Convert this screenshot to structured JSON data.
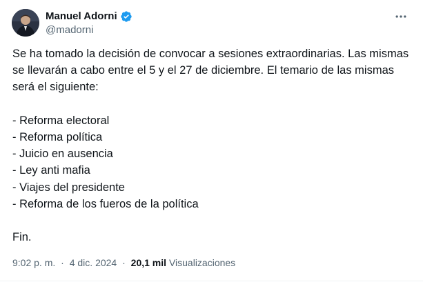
{
  "author": {
    "display_name": "Manuel Adorni",
    "handle": "@madorni",
    "verified": true
  },
  "tweet": {
    "intro": "Se ha tomado la decisión de convocar a sesiones extraordinarias. Las mismas se llevarán a cabo entre el 5 y el 27 de diciembre. El temario de las mismas será el siguiente:",
    "items": [
      "- Reforma electoral",
      "- Reforma política",
      "- Juicio en ausencia",
      "- Ley anti mafia",
      "- Viajes del presidente",
      "- Reforma de los fueros de la política"
    ],
    "closing": "Fin."
  },
  "meta": {
    "time": "9:02 p. m.",
    "separator": "·",
    "date": "4 dic. 2024",
    "views_count": "20,1 mil",
    "views_label": "Visualizaciones"
  },
  "icons": {
    "verified": "verified-badge-icon",
    "more": "more-options-icon"
  },
  "colors": {
    "verified_blue": "#1d9bf0",
    "secondary_text": "#536471",
    "primary_text": "#0f1419"
  }
}
